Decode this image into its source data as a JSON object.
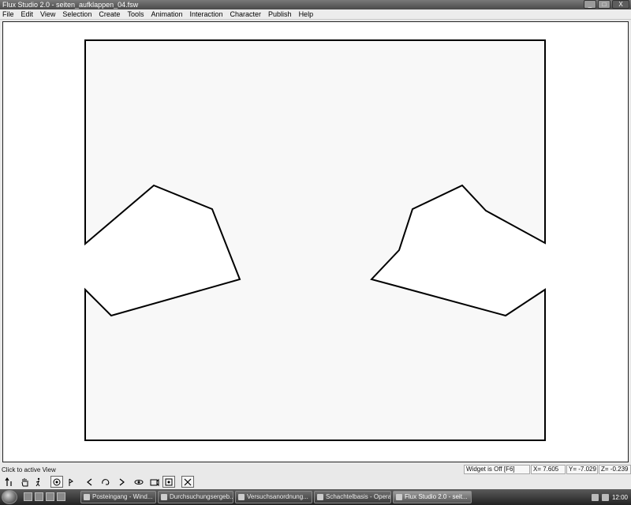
{
  "window": {
    "title": "Flux Studio 2.0 - seiten_aufklappen_04.fsw",
    "buttons": {
      "minimize": "_",
      "maximize": "□",
      "close": "X"
    }
  },
  "menu": [
    "File",
    "Edit",
    "View",
    "Selection",
    "Create",
    "Tools",
    "Animation",
    "Interaction",
    "Character",
    "Publish",
    "Help"
  ],
  "status": {
    "message": "Click to active View",
    "widget": "Widget is Off  [F6]",
    "x": "X=  7.605",
    "y": "Y=  -7.029",
    "z": "Z=  -0.239"
  },
  "toolbar": {
    "icons": [
      "pointer-up-icon",
      "hand-icon",
      "walk-icon",
      "camera-icon",
      "fly-icon",
      "step-back-icon",
      "rotate-icon",
      "play-icon",
      "orbit-icon",
      "view-icon",
      "fit-icon",
      "close-view-icon"
    ]
  },
  "taskbar": {
    "tasks": [
      {
        "label": "Posteingang - Wind...",
        "active": false
      },
      {
        "label": "Durchsuchungsergeb...",
        "active": false
      },
      {
        "label": "Versuchsanordnung...",
        "active": false
      },
      {
        "label": "Schachtelbasis - Opera",
        "active": false
      },
      {
        "label": "Flux Studio 2.0 - seit...",
        "active": true
      }
    ],
    "clock": "12:00"
  }
}
